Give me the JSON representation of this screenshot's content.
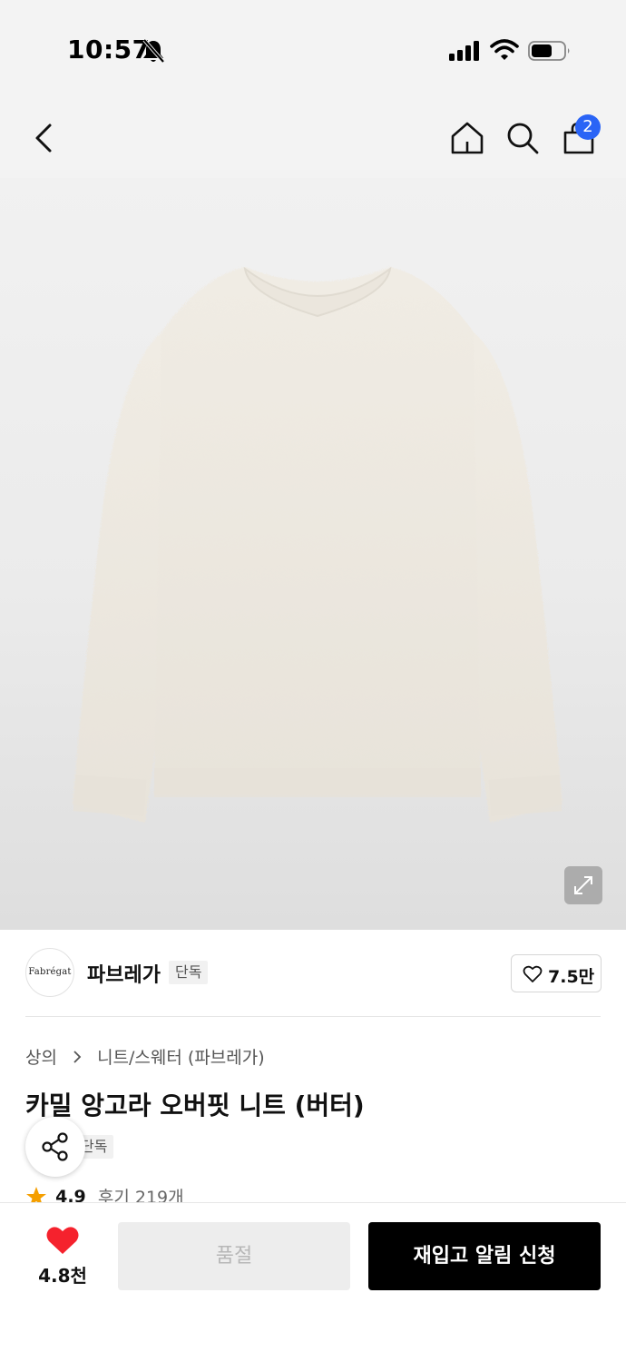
{
  "status_bar": {
    "time": "10:57",
    "icons": [
      "bell-off-icon",
      "signal-icon",
      "wifi-icon",
      "battery-icon"
    ]
  },
  "nav": {
    "icons": [
      "back-icon",
      "home-icon",
      "search-icon",
      "cart-icon"
    ],
    "cart_count": "2",
    "badge_color": "#2a64f6"
  },
  "product_image": {
    "icon": "expand-icon"
  },
  "brand": {
    "logo_text": "Fabrégat",
    "name": "파브레가",
    "tag": "단독",
    "likes": "7.5만"
  },
  "breadcrumb": {
    "category": "상의",
    "subcategory": "니트/스웨터 (파브레가)"
  },
  "product": {
    "title": "카밀 앙고라 오버핏 니트 (버터)",
    "tag": "단독",
    "rating": "4.9",
    "reviews": "후기 219개"
  },
  "bottom_bar": {
    "wish_count": "4.8천",
    "soldout_label": "품절",
    "restock_label": "재입고 알림 신청",
    "heart_color": "#f5222d",
    "star_color": "#f59f00"
  }
}
